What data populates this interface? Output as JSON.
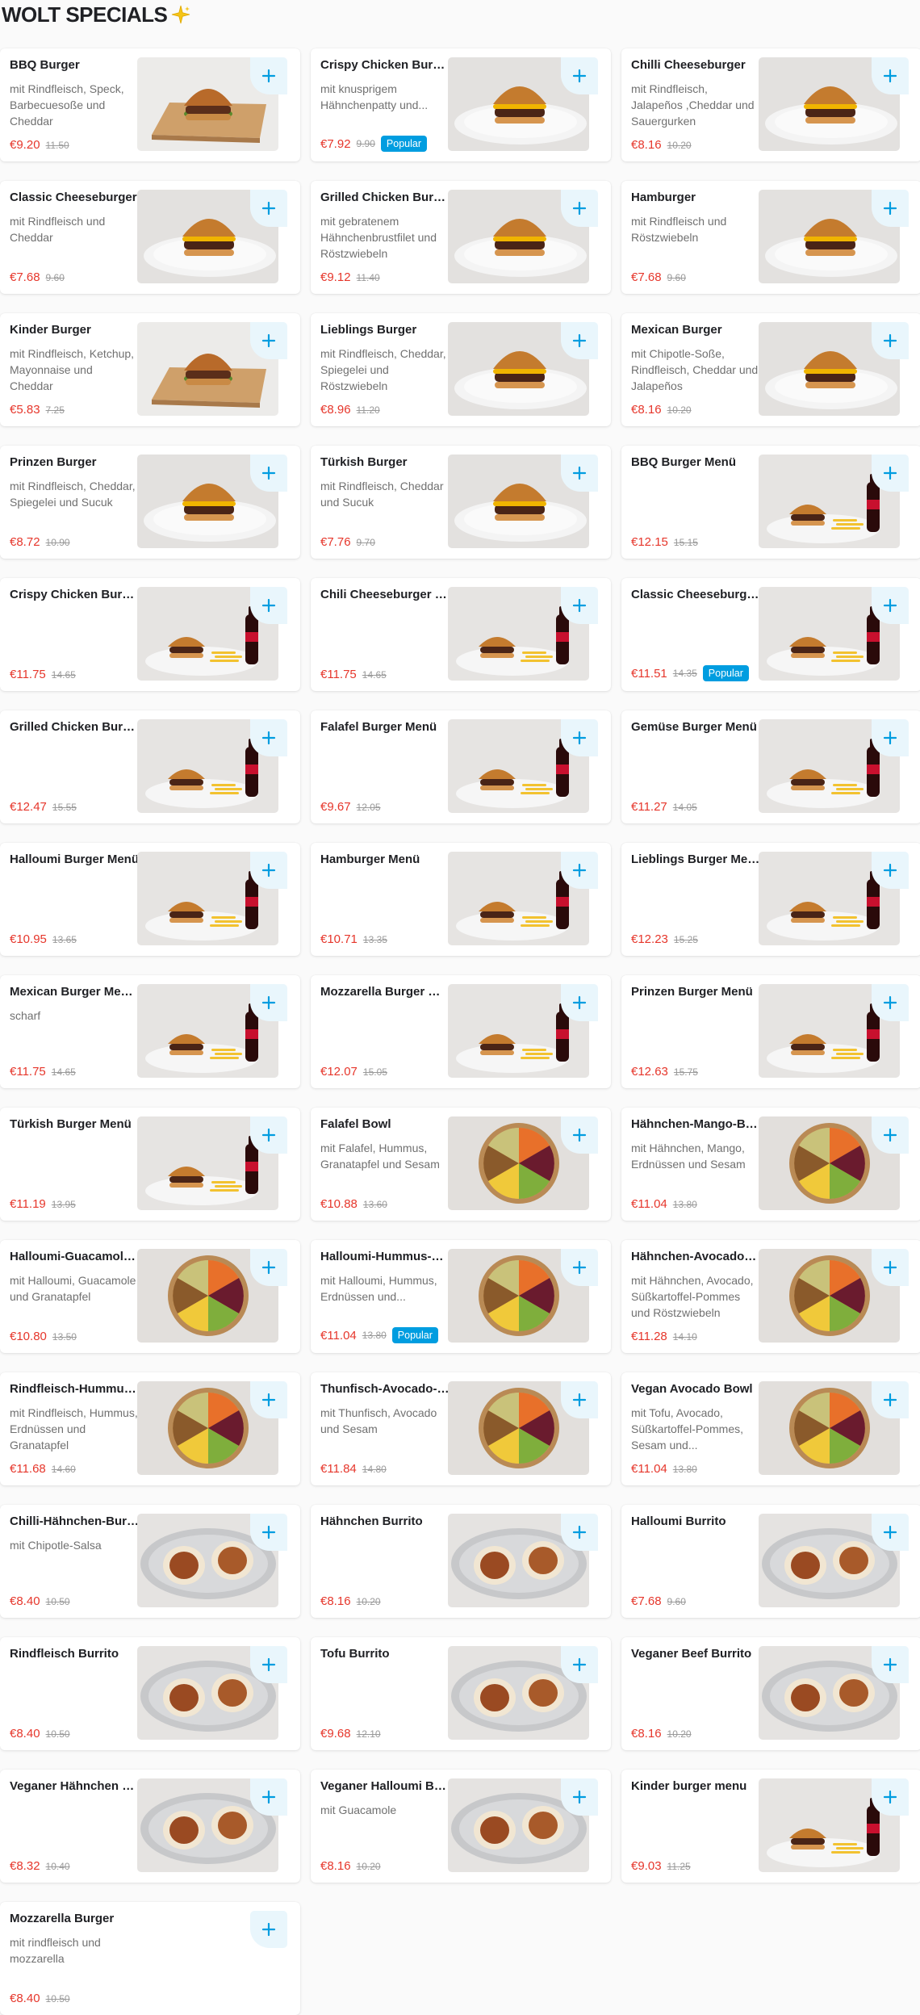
{
  "section": {
    "title": "WOLT SPECIALS",
    "icon": "sparkle-icon",
    "accent": "#009de0",
    "price_color": "#e6362b"
  },
  "items": [
    {
      "name": "BBQ Burger",
      "desc": "mit Rindfleisch, Speck, Barbecuesoße und Cheddar",
      "price": "€9.20",
      "old": "11.50",
      "badge": "",
      "img": "burger-board"
    },
    {
      "name": "Crispy Chicken Burger",
      "desc": "mit knusprigem Hähnchenpatty und...",
      "price": "€7.92",
      "old": "9.90",
      "badge": "Popular",
      "img": "burger-plate"
    },
    {
      "name": "Chilli Cheeseburger",
      "desc": "mit Rindfleisch, Jalapeños ,Cheddar und Sauergurken",
      "price": "€8.16",
      "old": "10.20",
      "badge": "",
      "img": "burger-plate"
    },
    {
      "name": "Classic Cheeseburger",
      "desc": "mit Rindfleisch und Cheddar",
      "price": "€7.68",
      "old": "9.60",
      "badge": "",
      "img": "burger-plate"
    },
    {
      "name": "Grilled Chicken Burger",
      "desc": "mit gebratenem Hähnchenbrustfilet und Röstzwiebeln",
      "price": "€9.12",
      "old": "11.40",
      "badge": "",
      "img": "burger-plate"
    },
    {
      "name": "Hamburger",
      "desc": "mit Rindfleisch und Röstzwiebeln",
      "price": "€7.68",
      "old": "9.60",
      "badge": "",
      "img": "burger-plate"
    },
    {
      "name": "Kinder Burger",
      "desc": "mit Rindfleisch, Ketchup, Mayonnaise und Cheddar",
      "price": "€5.83",
      "old": "7.25",
      "badge": "",
      "img": "burger-board"
    },
    {
      "name": "Lieblings Burger",
      "desc": "mit Rindfleisch, Cheddar, Spiegelei und Röstzwiebeln",
      "price": "€8.96",
      "old": "11.20",
      "badge": "",
      "img": "burger-plate"
    },
    {
      "name": "Mexican Burger",
      "desc": "mit Chipotle-Soße, Rindfleisch, Cheddar und Jalapeños",
      "price": "€8.16",
      "old": "10.20",
      "badge": "",
      "img": "burger-plate"
    },
    {
      "name": "Prinzen Burger",
      "desc": "mit Rindfleisch, Cheddar, Spiegelei und Sucuk",
      "price": "€8.72",
      "old": "10.90",
      "badge": "",
      "img": "burger-plate"
    },
    {
      "name": "Türkish Burger",
      "desc": "mit Rindfleisch, Cheddar und Sucuk",
      "price": "€7.76",
      "old": "9.70",
      "badge": "",
      "img": "burger-plate"
    },
    {
      "name": "BBQ Burger Menü",
      "desc": "",
      "price": "€12.15",
      "old": "15.15",
      "badge": "",
      "img": "menu"
    },
    {
      "name": "Crispy Chicken Burger...",
      "desc": "",
      "price": "€11.75",
      "old": "14.65",
      "badge": "",
      "img": "menu"
    },
    {
      "name": "Chili Cheeseburger M...",
      "desc": "",
      "price": "€11.75",
      "old": "14.65",
      "badge": "",
      "img": "menu"
    },
    {
      "name": "Classic Cheeseburger...",
      "desc": "",
      "price": "€11.51",
      "old": "14.35",
      "badge": "Popular",
      "img": "menu"
    },
    {
      "name": "Grilled Chicken Burge...",
      "desc": "",
      "price": "€12.47",
      "old": "15.55",
      "badge": "",
      "img": "menu"
    },
    {
      "name": "Falafel Burger Menü",
      "desc": "",
      "price": "€9.67",
      "old": "12.05",
      "badge": "",
      "img": "menu"
    },
    {
      "name": "Gemüse Burger Menü",
      "desc": "",
      "price": "€11.27",
      "old": "14.05",
      "badge": "",
      "img": "menu"
    },
    {
      "name": "Halloumi Burger Menü",
      "desc": "",
      "price": "€10.95",
      "old": "13.65",
      "badge": "",
      "img": "menu"
    },
    {
      "name": "Hamburger Menü",
      "desc": "",
      "price": "€10.71",
      "old": "13.35",
      "badge": "",
      "img": "menu"
    },
    {
      "name": "Lieblings Burger Menü",
      "desc": "",
      "price": "€12.23",
      "old": "15.25",
      "badge": "",
      "img": "menu"
    },
    {
      "name": "Mexican Burger Menü ...",
      "desc": "scharf",
      "price": "€11.75",
      "old": "14.65",
      "badge": "",
      "img": "menu"
    },
    {
      "name": "Mozzarella Burger Me...",
      "desc": "",
      "price": "€12.07",
      "old": "15.05",
      "badge": "",
      "img": "menu"
    },
    {
      "name": "Prinzen Burger Menü",
      "desc": "",
      "price": "€12.63",
      "old": "15.75",
      "badge": "",
      "img": "menu"
    },
    {
      "name": "Türkish Burger Menü",
      "desc": "",
      "price": "€11.19",
      "old": "13.95",
      "badge": "",
      "img": "menu"
    },
    {
      "name": "Falafel Bowl",
      "desc": "mit Falafel, Hummus, Granatapfel und Sesam",
      "price": "€10.88",
      "old": "13.60",
      "badge": "",
      "img": "bowl"
    },
    {
      "name": "Hähnchen-Mango-Bowl",
      "desc": "mit Hähnchen, Mango, Erdnüssen und Sesam",
      "price": "€11.04",
      "old": "13.80",
      "badge": "",
      "img": "bowl"
    },
    {
      "name": "Halloumi-Guacamole-...",
      "desc": "mit Halloumi, Guacamole und Granatapfel",
      "price": "€10.80",
      "old": "13.50",
      "badge": "",
      "img": "bowl"
    },
    {
      "name": "Halloumi-Hummus-Bo...",
      "desc": "mit Halloumi, Hummus, Erdnüssen und...",
      "price": "€11.04",
      "old": "13.80",
      "badge": "Popular",
      "img": "bowl"
    },
    {
      "name": "Hähnchen-Avocado-B...",
      "desc": "mit Hähnchen, Avocado, Süßkartoffel-Pommes und Röstzwiebeln",
      "price": "€11.28",
      "old": "14.10",
      "badge": "",
      "img": "bowl"
    },
    {
      "name": "Rindfleisch-Hummus-...",
      "desc": "mit Rindfleisch, Hummus, Erdnüssen und Granatapfel",
      "price": "€11.68",
      "old": "14.60",
      "badge": "",
      "img": "bowl"
    },
    {
      "name": "Thunfisch-Avocado-B...",
      "desc": "mit Thunfisch, Avocado und Sesam",
      "price": "€11.84",
      "old": "14.80",
      "badge": "",
      "img": "bowl"
    },
    {
      "name": "Vegan Avocado Bowl",
      "desc": "mit Tofu, Avocado, Süßkartoffel-Pommes, Sesam und...",
      "price": "€11.04",
      "old": "13.80",
      "badge": "",
      "img": "bowl"
    },
    {
      "name": "Chilli-Hähnchen-Burrito",
      "desc": "mit Chipotle-Salsa",
      "price": "€8.40",
      "old": "10.50",
      "badge": "",
      "img": "burrito"
    },
    {
      "name": "Hähnchen Burrito",
      "desc": "",
      "price": "€8.16",
      "old": "10.20",
      "badge": "",
      "img": "burrito"
    },
    {
      "name": "Halloumi Burrito",
      "desc": "",
      "price": "€7.68",
      "old": "9.60",
      "badge": "",
      "img": "burrito"
    },
    {
      "name": "Rindfleisch Burrito",
      "desc": "",
      "price": "€8.40",
      "old": "10.50",
      "badge": "",
      "img": "burrito"
    },
    {
      "name": "Tofu Burrito",
      "desc": "",
      "price": "€9.68",
      "old": "12.10",
      "badge": "",
      "img": "burrito"
    },
    {
      "name": "Veganer Beef Burrito",
      "desc": "",
      "price": "€8.16",
      "old": "10.20",
      "badge": "",
      "img": "burrito"
    },
    {
      "name": "Veganer Hähnchen Bu...",
      "desc": "",
      "price": "€8.32",
      "old": "10.40",
      "badge": "",
      "img": "burrito"
    },
    {
      "name": "Veganer Halloumi Bur...",
      "desc": "mit Guacamole",
      "price": "€8.16",
      "old": "10.20",
      "badge": "",
      "img": "burrito"
    },
    {
      "name": "Kinder burger menu",
      "desc": "",
      "price": "€9.03",
      "old": "11.25",
      "badge": "",
      "img": "menu"
    },
    {
      "name": "Mozzarella Burger",
      "desc": "mit rindfleisch und mozzarella",
      "price": "€8.40",
      "old": "10.50",
      "badge": "",
      "img": "none"
    }
  ]
}
